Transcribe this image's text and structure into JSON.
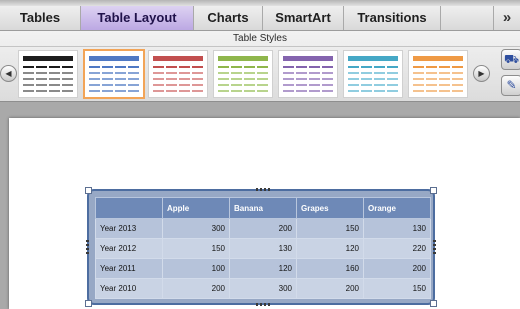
{
  "ribbon": {
    "tabs": [
      {
        "label": "Tables",
        "active": false
      },
      {
        "label": "Table Layout",
        "active": true
      },
      {
        "label": "Charts",
        "active": false
      },
      {
        "label": "SmartArt",
        "active": false
      },
      {
        "label": "Transitions",
        "active": false
      }
    ],
    "more_label": "»",
    "group_title": "Table Styles",
    "styles": [
      {
        "name": "black",
        "header_color": "#1d1d1d",
        "line_color": "#8a8a8a",
        "selected": false
      },
      {
        "name": "blue",
        "header_color": "#4f79c4",
        "line_color": "#87a4d6",
        "selected": true
      },
      {
        "name": "red",
        "header_color": "#c24f4f",
        "line_color": "#de9797",
        "selected": false
      },
      {
        "name": "green",
        "header_color": "#8fb64c",
        "line_color": "#b8d48d",
        "selected": false
      },
      {
        "name": "purple",
        "header_color": "#8464ae",
        "line_color": "#b19bcd",
        "selected": false
      },
      {
        "name": "teal",
        "header_color": "#45a8c6",
        "line_color": "#90cde0",
        "selected": false
      },
      {
        "name": "orange",
        "header_color": "#ef9a45",
        "line_color": "#f5c28e",
        "selected": false
      }
    ],
    "prev_icon": "chevron-left-icon",
    "next_icon": "chevron-right-icon",
    "side_tools": [
      "paint-bucket-icon",
      "eraser-icon"
    ]
  },
  "table": {
    "columns": [
      "",
      "Apple",
      "Banana",
      "Grapes",
      "Orange"
    ],
    "rows": [
      {
        "label": "Year 2013",
        "values": [
          "300",
          "200",
          "150",
          "130"
        ]
      },
      {
        "label": "Year 2012",
        "values": [
          "150",
          "130",
          "120",
          "220"
        ]
      },
      {
        "label": "Year 2011",
        "values": [
          "100",
          "120",
          "160",
          "200"
        ]
      },
      {
        "label": "Year 2010",
        "values": [
          "200",
          "300",
          "200",
          "150"
        ]
      }
    ]
  }
}
